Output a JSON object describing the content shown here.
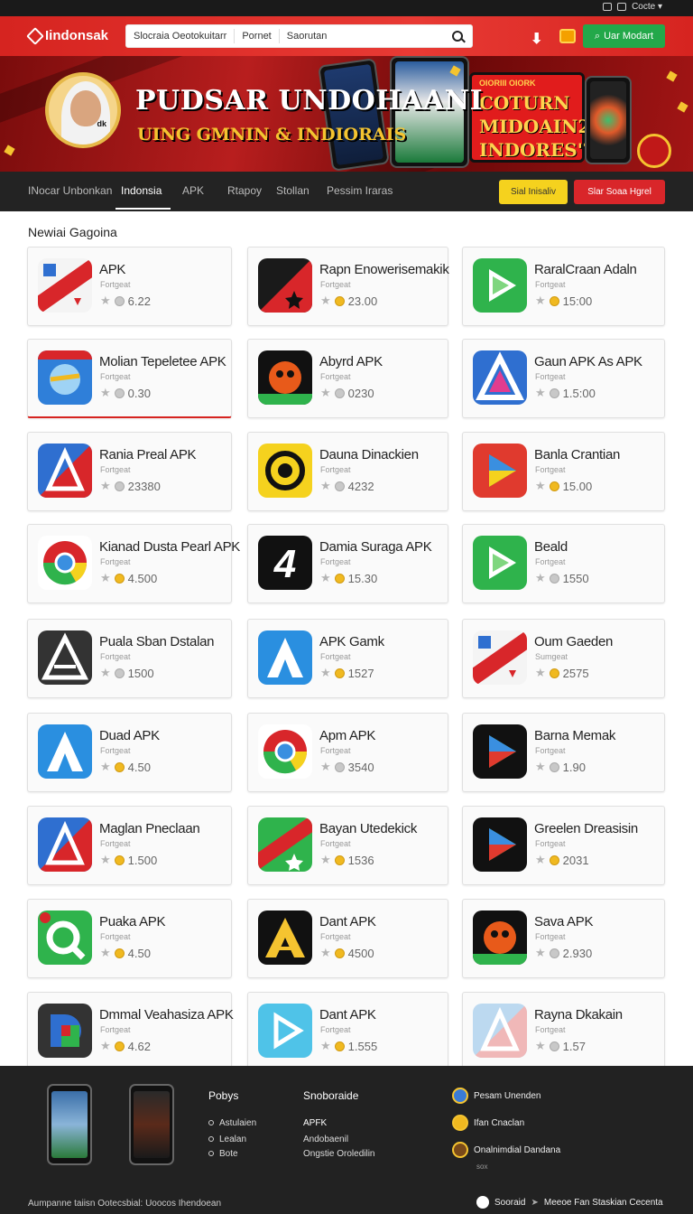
{
  "topbar": {
    "user_label": "Cocte"
  },
  "header": {
    "logo": "Iindonsak",
    "search_segments": [
      "Slocraia Oeotokuitarr",
      "Pornet",
      "Saorutan"
    ],
    "cta_label": "Uar Modart"
  },
  "banner": {
    "title": "PUDSAR UNDOHAANI",
    "subtitle": "UING GMNIN & INDIORAIS",
    "promo_small": "OIORIII OIORK",
    "promo_big": "COTURN\nMIDOAIN2con\nINDORES'?",
    "avatar_tag": "dk"
  },
  "nav": {
    "items": [
      "INocar Unbonkan",
      "Indonsia",
      "APK",
      "Rtapoy",
      "Stollan",
      "Pessim Iraras"
    ],
    "active_index": 1,
    "button_yellow": "Sial Inisaliv",
    "button_red": "Slar Soaa Hgrel"
  },
  "section_title": "Newiai Gagoina",
  "apps": [
    {
      "name": "APK",
      "category": "Fortgeat",
      "rating": "6.22",
      "badge": "grey",
      "icon": "striped-red-icon"
    },
    {
      "name": "Rapn Enowerisemakik",
      "category": "Fortgeat",
      "rating": "23.00",
      "badge": "gold",
      "icon": "star-split-icon"
    },
    {
      "name": "RaralCraan Adaln",
      "category": "Fortgeat",
      "rating": "15:00",
      "badge": "gold",
      "icon": "green-play-icon"
    },
    {
      "name": "Molian Tepeletee APK",
      "category": "Fortgeat",
      "rating": "0.30",
      "badge": "grey",
      "icon": "globe-arrow-icon"
    },
    {
      "name": "Abyrd APK",
      "category": "Fortgeat",
      "rating": "0230",
      "badge": "grey",
      "icon": "robot-face-icon"
    },
    {
      "name": "Gaun APK As APK",
      "category": "Fortgeat",
      "rating": "1.5:00",
      "badge": "grey",
      "icon": "triangle-a-icon"
    },
    {
      "name": "Rania Preal APK",
      "category": "Fortgeat",
      "rating": "23380",
      "badge": "grey",
      "icon": "blue-red-a-icon"
    },
    {
      "name": "Dauna Dinackien",
      "category": "Fortgeat",
      "rating": "4232",
      "badge": "grey",
      "icon": "yellow-at-icon"
    },
    {
      "name": "Banla Crantian",
      "category": "Fortgeat",
      "rating": "15.00",
      "badge": "gold",
      "icon": "red-play-icon"
    },
    {
      "name": "Kianad Dusta Pearl APK",
      "category": "Fortgeat",
      "rating": "4.500",
      "badge": "gold",
      "icon": "chrome-like-icon"
    },
    {
      "name": "Damia Suraga APK",
      "category": "Fortgeat",
      "rating": "15.30",
      "badge": "gold",
      "icon": "number-four-icon"
    },
    {
      "name": "Beald",
      "category": "Fortgeat",
      "rating": "1550",
      "badge": "grey",
      "icon": "green-play-icon"
    },
    {
      "name": "Puala Sban Dstalan",
      "category": "Fortgeat",
      "rating": "1500",
      "badge": "grey",
      "icon": "dark-a-icon"
    },
    {
      "name": "APK Gamk",
      "category": "Fortgeat",
      "rating": "1527",
      "badge": "gold",
      "icon": "blue-a-icon"
    },
    {
      "name": "Oum Gaeden",
      "category": "Sumgeat",
      "rating": "2575",
      "badge": "gold",
      "icon": "striped-red-icon"
    },
    {
      "name": "Duad APK",
      "category": "Fortgeat",
      "rating": "4.50",
      "badge": "gold",
      "icon": "blue-a-icon"
    },
    {
      "name": "Apm APK",
      "category": "Fortgeat",
      "rating": "3540",
      "badge": "grey",
      "icon": "chrome-like-icon"
    },
    {
      "name": "Barna Memak",
      "category": "Fortgeat",
      "rating": "1.90",
      "badge": "grey",
      "icon": "black-play-icon"
    },
    {
      "name": "Maglan Pneclaan",
      "category": "Fortgeat",
      "rating": "1.500",
      "badge": "gold",
      "icon": "blue-red-a-icon"
    },
    {
      "name": "Bayan Utedekick",
      "category": "Fortgeat",
      "rating": "1536",
      "badge": "gold",
      "icon": "green-striped-icon"
    },
    {
      "name": "Greelen Dreasisin",
      "category": "Fortgeat",
      "rating": "2031",
      "badge": "gold",
      "icon": "black-play-icon"
    },
    {
      "name": "Puaka APK",
      "category": "Fortgeat",
      "rating": "4.50",
      "badge": "gold",
      "icon": "green-q-icon"
    },
    {
      "name": "Dant APK",
      "category": "Fortgeat",
      "rating": "4500",
      "badge": "gold",
      "icon": "yellow-a-icon"
    },
    {
      "name": "Sava APK",
      "category": "Fortgeat",
      "rating": "2.930",
      "badge": "grey",
      "icon": "robot-face-icon"
    },
    {
      "name": "Dmmal Veahasiza APK",
      "category": "Fortgeat",
      "rating": "4.62",
      "badge": "gold",
      "icon": "d-mark-icon"
    },
    {
      "name": "Dant APK",
      "category": "Fortgeat",
      "rating": "1.555",
      "badge": "gold",
      "icon": "cyan-play-icon"
    },
    {
      "name": "Rayna Dkakain",
      "category": "Fortgeat",
      "rating": "1.57",
      "badge": "grey",
      "icon": "faded-a-icon"
    }
  ],
  "footer": {
    "col1_title": "Pobys",
    "col1_links": [
      "Astulaien",
      "Lealan",
      "Bote"
    ],
    "col2_title": "Snoboraide",
    "col2_links": [
      "APFK",
      "Andobaenil",
      "Ongstie Oroledilin"
    ],
    "social": [
      "Pesam Unenden",
      "Ifan Cnaclan",
      "Onalnimdial Dandana"
    ],
    "social_sub": "sox",
    "copyright": "Aumpanne taiisn Ootecsbial: Uoocos Ihendoean",
    "bottom_right": [
      "Sooraid",
      "Meeoe Fan Staskian Cecenta"
    ]
  },
  "colors": {
    "brand_red": "#d62420",
    "accent_green": "#23a84a",
    "accent_yellow": "#f5d21e"
  }
}
